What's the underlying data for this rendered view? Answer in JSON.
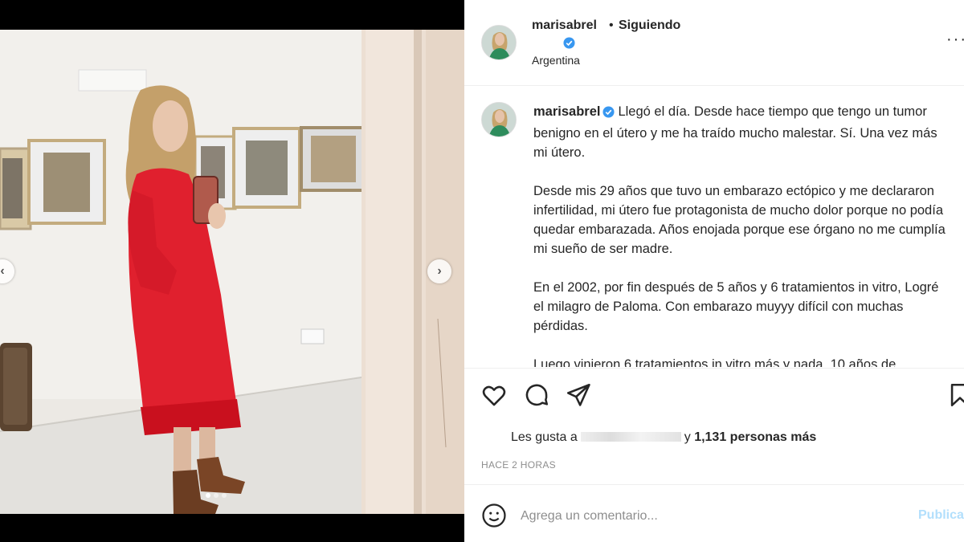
{
  "post": {
    "username": "marisabrel",
    "separator": "•",
    "follow_status": "Siguiendo",
    "location": "Argentina",
    "more_label": "···"
  },
  "caption": {
    "username": "marisabrel",
    "paragraphs": [
      "Llegó el día. Desde hace tiempo que tengo un tumor benigno en el útero y me ha traído mucho malestar. Sí. Una vez más mi útero.",
      "Desde mis 29 años que tuvo un embarazo ectópico y me declararon infertilidad, mi útero fue protagonista de mucho dolor porque no podía quedar embarazada. Años enojada porque ese órgano no me cumplía mi sueño de ser madre.",
      "En el 2002, por fin después de 5 años y 6 tratamientos in vitro, Logré el milagro de Paloma. Con embarazo muyyy difícil con muchas pérdidas.",
      "Luego vinieron 6 tratamientos in vitro más y nada. 10 años de"
    ]
  },
  "likes": {
    "prefix": "Les gusta a",
    "suffix_connector": "y",
    "count_text": "1,131 personas más"
  },
  "timestamp": "HACE 2 HORAS",
  "comment_box": {
    "placeholder": "Agrega un comentario...",
    "publish_label": "Publicar"
  },
  "carousel": {
    "prev_label": "‹",
    "next_label": "›",
    "slides": 3,
    "active_slide": 1
  },
  "colors": {
    "verified": "#3897f0",
    "publish": "#b2dffc",
    "dress": "#e0202e"
  },
  "icons": [
    "verified-badge-icon",
    "heart-icon",
    "comment-bubble-icon",
    "paper-plane-icon",
    "bookmark-icon",
    "emoji-smile-icon",
    "chevron-left-icon",
    "chevron-right-icon"
  ]
}
